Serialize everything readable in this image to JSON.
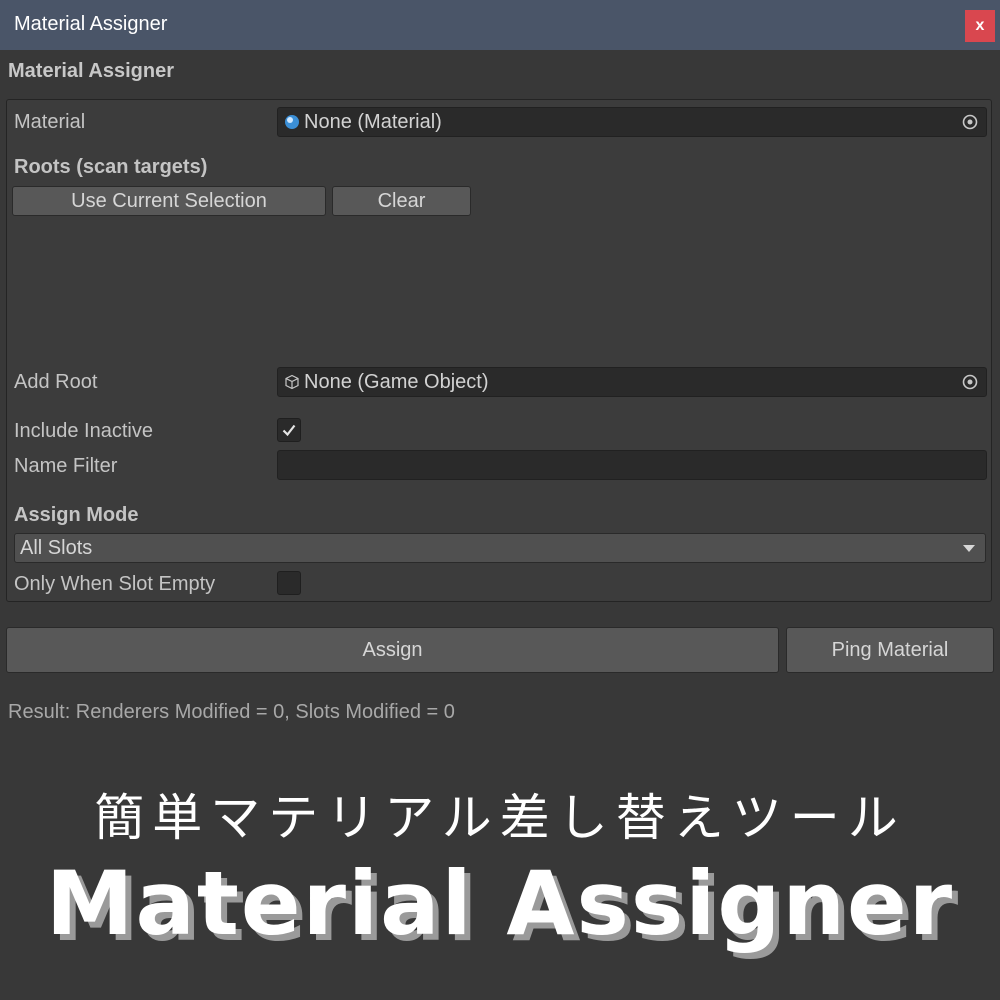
{
  "window": {
    "title": "Material Assigner",
    "close_label": "x"
  },
  "panel": {
    "header": "Material Assigner"
  },
  "material": {
    "label": "Material",
    "value": "None (Material)"
  },
  "roots": {
    "label": "Roots (scan targets)",
    "use_selection_label": "Use Current Selection",
    "clear_label": "Clear"
  },
  "add_root": {
    "label": "Add Root",
    "value": "None (Game Object)"
  },
  "include_inactive": {
    "label": "Include Inactive",
    "checked": true
  },
  "name_filter": {
    "label": "Name Filter",
    "value": ""
  },
  "assign_mode": {
    "label": "Assign Mode",
    "selected": "All Slots"
  },
  "only_when_empty": {
    "label": "Only When Slot Empty",
    "checked": false
  },
  "actions": {
    "assign_label": "Assign",
    "ping_label": "Ping Material"
  },
  "result_text": "Result: Renderers Modified = 0, Slots Modified = 0",
  "banner": {
    "subtitle": "簡単マテリアル差し替えツール",
    "title": "Material Assigner"
  },
  "colors": {
    "accent_close": "#d9474f",
    "titlebar": "#4a5568",
    "background": "#383838"
  }
}
